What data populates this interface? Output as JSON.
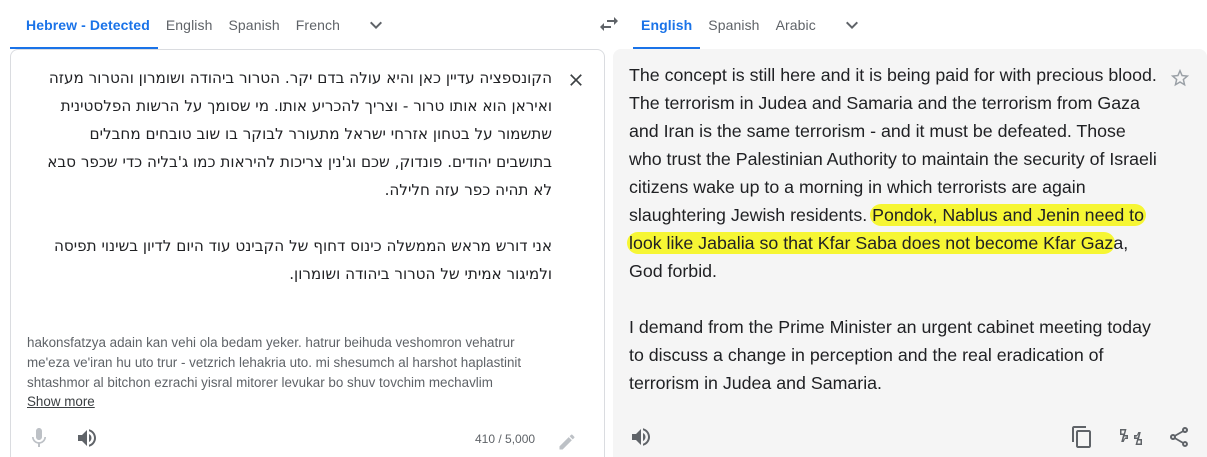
{
  "source_languages": {
    "tabs": [
      "Hebrew - Detected",
      "English",
      "Spanish",
      "French"
    ],
    "active_index": 0
  },
  "target_languages": {
    "tabs": [
      "English",
      "Spanish",
      "Arabic"
    ],
    "active_index": 0
  },
  "source": {
    "text": "הקונספציה עדיין כאן והיא עולה בדם יקר. הטרור ביהודה ושומרון והטרור מעזה ואיראן הוא אותו טרור - וצריך להכריע אותו. מי שסומך על הרשות הפלסטינית שתשמור על בטחון אזרחי ישראל מתעורר לבוקר בו שוב טובחים מחבלים בתושבים יהודים. פונדוק, שכם וג'נין צריכות להיראות כמו ג'בליה כדי שכפר סבא לא תהיה כפר עזה חלילה.\n\nאני דורש מראש הממשלה כינוס דחוף של הקבינט עוד היום לדיון בשינוי תפיסה ולמיגור אמיתי של הטרור ביהודה ושומרון.",
    "transliteration": "hakonsfatzya adain kan vehi ola bedam yeker. hatrur beihuda veshomron vehatrur me'eza ve'iran hu uto trur - vetzrich lehakria uto. mi shesumch al harshot haplastinit shtashmor al bitchon ezrachi yisral mitorer levukar bo shuv tovchim mechavlim",
    "show_more_label": "Show more",
    "char_count": "410 / 5,000"
  },
  "target": {
    "text_before": "The concept is still here and it is being paid for with precious blood. The terrorism in Judea and Samaria and the terrorism from Gaza and Iran is the same terrorism - and it must be defeated. Those who trust the Palestinian Authority to maintain the security of Israeli citizens wake up to a morning in which terrorists are again slaughtering Jewish residents. ",
    "text_highlighted": "Pondok, Nablus and Jenin need to look like Jabalia so that Kfar Saba does not become Kfar Gaz",
    "text_after": "a, God forbid.\n\nI demand from the Prime Minister an urgent cabinet meeting today to discuss a change in perception and the real eradication of terrorism in Judea and Samaria."
  },
  "colors": {
    "accent": "#1a73e8",
    "highlight": "#f6f634",
    "icon": "#5f6368"
  },
  "icons": {
    "chevron": "chevron-down-icon",
    "swap": "swap-languages-icon",
    "clear": "close-icon",
    "mic": "microphone-icon",
    "speaker": "speaker-icon",
    "edit": "pencil-icon",
    "star": "star-icon",
    "copy": "copy-icon",
    "feedback": "rate-translation-icon",
    "share": "share-icon"
  }
}
